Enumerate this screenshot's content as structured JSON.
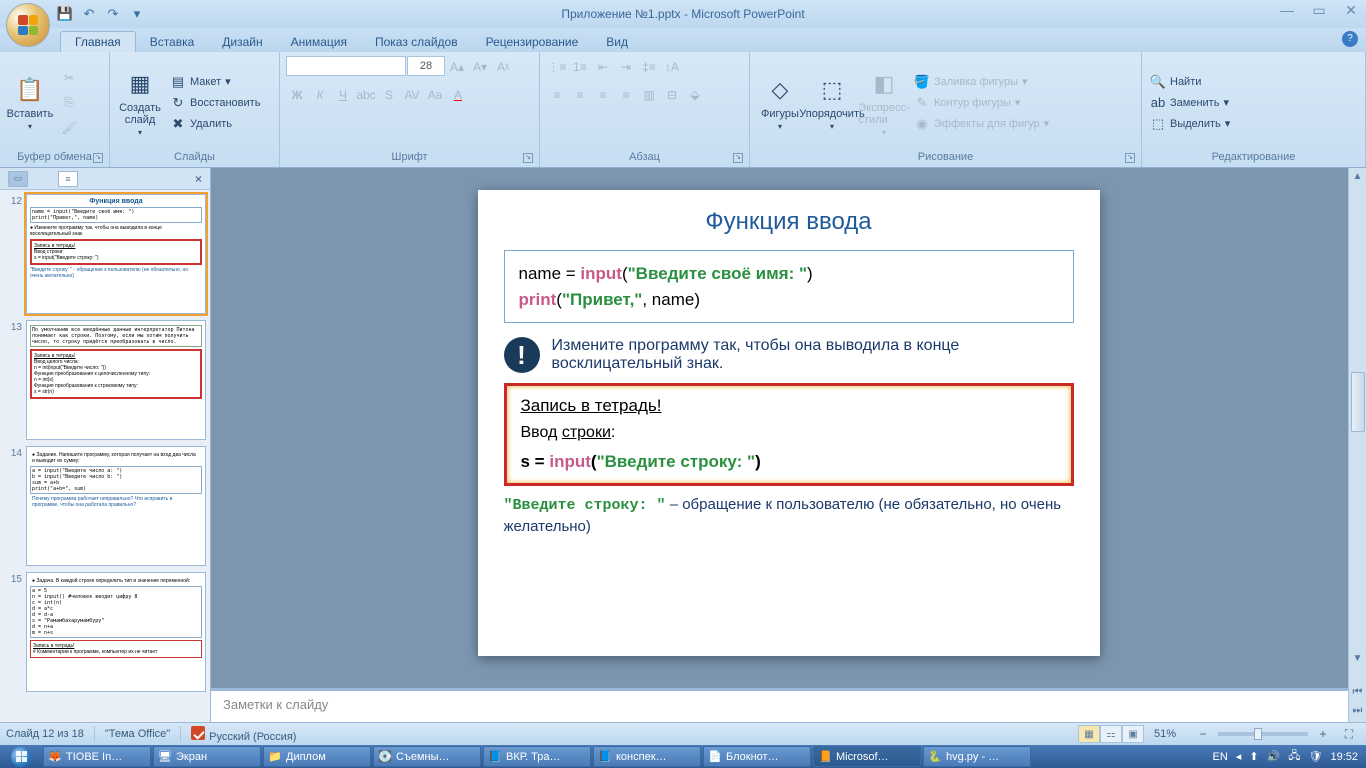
{
  "window": {
    "title": "Приложение №1.pptx - Microsoft PowerPoint"
  },
  "qat": {
    "save": "💾",
    "undo": "↶",
    "redo": "↷",
    "more": "▾"
  },
  "tabs": {
    "items": [
      "Главная",
      "Вставка",
      "Дизайн",
      "Анимация",
      "Показ слайдов",
      "Рецензирование",
      "Вид"
    ],
    "active": 0
  },
  "ribbon": {
    "clipboard": {
      "label": "Буфер обмена",
      "paste": "Вставить"
    },
    "slides": {
      "label": "Слайды",
      "new": "Создать\nслайд",
      "layout": "Макет",
      "reset": "Восстановить",
      "delete": "Удалить"
    },
    "font": {
      "label": "Шрифт",
      "size": "28"
    },
    "paragraph": {
      "label": "Абзац"
    },
    "drawing": {
      "label": "Рисование",
      "shapes": "Фигуры",
      "arrange": "Упорядочить",
      "quick": "Экспресс-стили",
      "fill": "Заливка фигуры",
      "outline": "Контур фигуры",
      "effects": "Эффекты для фигур"
    },
    "editing": {
      "label": "Редактирование",
      "find": "Найти",
      "replace": "Заменить",
      "select": "Выделить"
    }
  },
  "thumbs": {
    "items": [
      {
        "num": "12",
        "title": "Функция ввода"
      },
      {
        "num": "13",
        "title": ""
      },
      {
        "num": "14",
        "title": ""
      },
      {
        "num": "15",
        "title": ""
      }
    ],
    "selected": 0
  },
  "slide": {
    "title": "Функция ввода",
    "code1_l1_a": "name = ",
    "code1_l1_b": "input",
    "code1_l1_c": "(",
    "code1_l1_d": "\"Введите своё имя: \"",
    "code1_l1_e": ")",
    "code1_l2_a": "print",
    "code1_l2_b": "(",
    "code1_l2_c": "\"Привет,\"",
    "code1_l2_d": ", name)",
    "note": "Измените программу так, чтобы она выводила в конце восклицательный знак.",
    "red_hdr": "Запись в тетрадь!",
    "red_lbl_a": "Ввод ",
    "red_lbl_b": "строки",
    "red_lbl_c": ":",
    "red_code_a": "s = ",
    "red_code_b": "input",
    "red_code_c": "(",
    "red_code_d": "\"Введите строку: \"",
    "red_code_e": ")",
    "foot_a": "\"Введите строку: \"",
    "foot_b": " – обращение к пользователю (не обязательно, но очень желательно)"
  },
  "notes": {
    "placeholder": "Заметки к слайду"
  },
  "status": {
    "slide": "Слайд 12 из 18",
    "theme": "\"Тема Office\"",
    "lang": "Русский (Россия)",
    "zoom": "51%"
  },
  "taskbar": {
    "items": [
      {
        "icon": "🦊",
        "label": "TIOBE In…"
      },
      {
        "icon": "🖥",
        "label": "Экран"
      },
      {
        "icon": "📁",
        "label": "Диплом"
      },
      {
        "icon": "💽",
        "label": "Съемны…"
      },
      {
        "icon": "📘",
        "label": "ВКР. Тра…"
      },
      {
        "icon": "📘",
        "label": "конспек…"
      },
      {
        "icon": "📄",
        "label": "Блокнот…"
      },
      {
        "icon": "📙",
        "label": "Microsof…",
        "active": true
      },
      {
        "icon": "🐍",
        "label": "hvg.py - …"
      }
    ],
    "lang": "EN",
    "time": "19:52"
  }
}
